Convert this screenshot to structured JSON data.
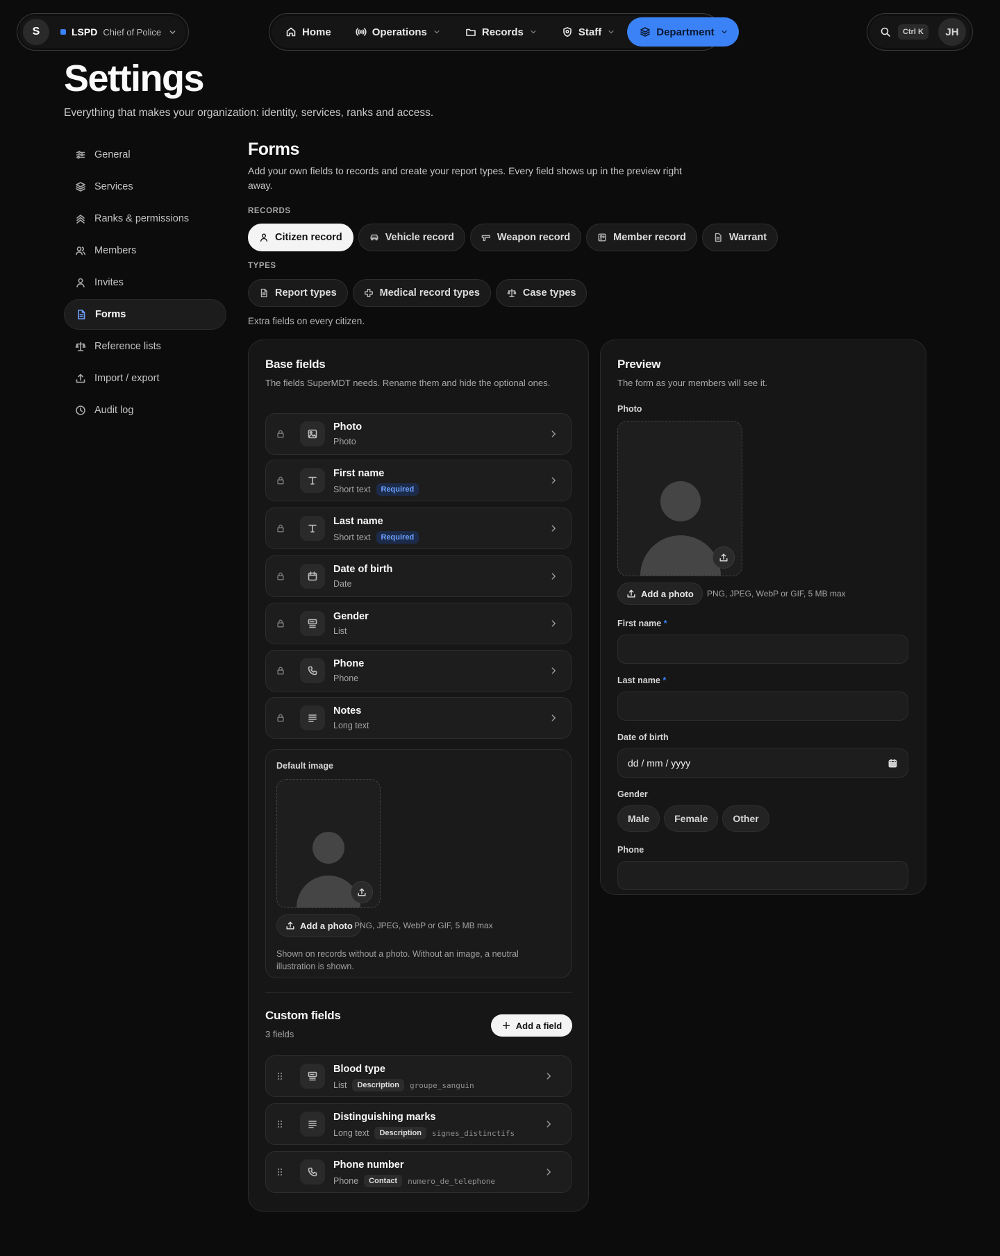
{
  "topbar": {
    "org_initial": "S",
    "org_name": "LSPD",
    "org_role": "Chief of Police",
    "nav": [
      {
        "label": "Home"
      },
      {
        "label": "Operations"
      },
      {
        "label": "Records"
      },
      {
        "label": "Staff"
      },
      {
        "label": "Department"
      }
    ],
    "shortcut": "Ctrl K",
    "user_initials": "JH",
    "accent": "#3b82f6"
  },
  "page": {
    "title": "Settings",
    "subtitle": "Everything that makes your organization: identity, services, ranks and access."
  },
  "sidebar": {
    "items": [
      {
        "label": "General",
        "icon": "sliders-icon"
      },
      {
        "label": "Services",
        "icon": "layers-icon"
      },
      {
        "label": "Ranks & permissions",
        "icon": "chevrons-up-icon"
      },
      {
        "label": "Members",
        "icon": "users-icon"
      },
      {
        "label": "Invites",
        "icon": "user-icon"
      },
      {
        "label": "Forms",
        "icon": "file-text-icon",
        "active": true
      },
      {
        "label": "Reference lists",
        "icon": "scale-icon"
      },
      {
        "label": "Import / export",
        "icon": "upload-icon"
      },
      {
        "label": "Audit log",
        "icon": "clock-icon"
      }
    ]
  },
  "forms": {
    "title": "Forms",
    "description": "Add your own fields to records and create your report types. Every field shows up in the preview right away.",
    "records_label": "RECORDS",
    "records": [
      {
        "label": "Citizen record",
        "active": true
      },
      {
        "label": "Vehicle record"
      },
      {
        "label": "Weapon record"
      },
      {
        "label": "Member record"
      },
      {
        "label": "Warrant"
      }
    ],
    "types_label": "TYPES",
    "types": [
      {
        "label": "Report types"
      },
      {
        "label": "Medical record types"
      },
      {
        "label": "Case types"
      }
    ],
    "extra_note": "Extra fields on every citizen."
  },
  "base_fields": {
    "title": "Base fields",
    "description": "The fields SuperMDT needs. Rename them and hide the optional ones.",
    "fields": [
      {
        "name": "Photo",
        "type": "Photo",
        "icon": "image-icon"
      },
      {
        "name": "First name",
        "type": "Short text",
        "badge": "Required",
        "icon": "type-icon"
      },
      {
        "name": "Last name",
        "type": "Short text",
        "badge": "Required",
        "icon": "type-icon"
      },
      {
        "name": "Date of birth",
        "type": "Date",
        "icon": "calendar-icon"
      },
      {
        "name": "Gender",
        "type": "List",
        "icon": "list-box-icon"
      },
      {
        "name": "Phone",
        "type": "Phone",
        "icon": "phone-icon"
      },
      {
        "name": "Notes",
        "type": "Long text",
        "icon": "align-left-icon"
      }
    ],
    "default_image": {
      "label": "Default image",
      "add_photo": "Add a photo",
      "hint": "PNG, JPEG, WebP or GIF, 5 MB max",
      "note": "Shown on records without a photo. Without an image, a neutral illustration is shown."
    }
  },
  "custom_fields": {
    "title": "Custom fields",
    "count": "3 fields",
    "add_button": "Add a field",
    "fields": [
      {
        "name": "Blood type",
        "type": "List",
        "category": "Description",
        "key": "groupe_sanguin",
        "icon": "list-box-icon"
      },
      {
        "name": "Distinguishing marks",
        "type": "Long text",
        "category": "Description",
        "key": "signes_distinctifs",
        "icon": "align-left-icon"
      },
      {
        "name": "Phone number",
        "type": "Phone",
        "category": "Contact",
        "key": "numero_de_telephone",
        "icon": "phone-icon"
      }
    ]
  },
  "preview": {
    "title": "Preview",
    "description": "The form as your members will see it.",
    "photo_label": "Photo",
    "add_photo": "Add a photo",
    "hint": "PNG, JPEG, WebP or GIF, 5 MB max",
    "first_name_label": "First name",
    "last_name_label": "Last name",
    "required_mark": "*",
    "dob_label": "Date of birth",
    "dob_placeholder": "dd / mm / yyyy",
    "gender_label": "Gender",
    "gender_options": [
      "Male",
      "Female",
      "Other"
    ],
    "phone_label": "Phone"
  }
}
